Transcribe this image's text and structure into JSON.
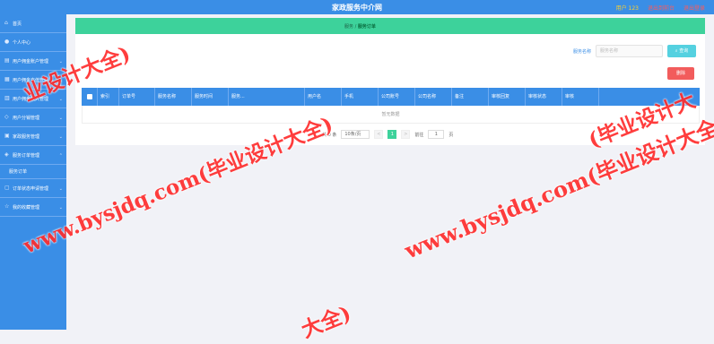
{
  "header": {
    "title": "家政服务中介网",
    "user": "用户 123",
    "link_back": "退出到前台",
    "link_logout": "退出登录"
  },
  "sidebar": {
    "items": [
      {
        "label": "首页",
        "icon": "home-icon"
      },
      {
        "label": "个人中心",
        "icon": "user-icon"
      },
      {
        "label": "用户佣金账户管理",
        "icon": "wallet-icon"
      },
      {
        "label": "用户佣金充值管理",
        "icon": "coin-icon"
      },
      {
        "label": "用户佣金收入管理",
        "icon": "chart-icon"
      },
      {
        "label": "用户分销管理",
        "icon": "share-icon"
      },
      {
        "label": "家政服务管理",
        "icon": "service-icon"
      },
      {
        "label": "服务订单管理",
        "icon": "order-icon"
      }
    ],
    "subitem": "服务订单",
    "items2": [
      {
        "label": "订单状态申请管理",
        "icon": "state-icon"
      },
      {
        "label": "我的收藏管理",
        "icon": "star-icon"
      }
    ]
  },
  "breadcrumb": {
    "prefix": "服务",
    "current": "服务订单"
  },
  "search": {
    "label": "服务名称",
    "placeholder": "服务名称",
    "button": "查询"
  },
  "delete_button": "删除",
  "table": {
    "headers": [
      "索引",
      "订单号",
      "服务名称",
      "服务时间",
      "服务...",
      "用户名",
      "手机",
      "公司账号",
      "公司名称",
      "备注",
      "审核回复",
      "审核状态",
      "审核"
    ],
    "empty_text": "暂无数据"
  },
  "pager": {
    "total": "共 0 条",
    "page_size": "10条/页",
    "prev": "<",
    "current_page": "1",
    "next": ">",
    "goto_prefix": "前往",
    "goto_value": "1",
    "goto_suffix": "页"
  },
  "watermark": "www.bysjdq.com(毕业设计大全)",
  "watermark_fragment_top": "业设计大全)",
  "watermark_fragment_right": "(毕业设计大",
  "watermark_fragment_bottom": "大全)",
  "colors": {
    "sidebar": "#3a8ee6",
    "green": "#3dd29b",
    "watermark": "#ff2d2d"
  }
}
